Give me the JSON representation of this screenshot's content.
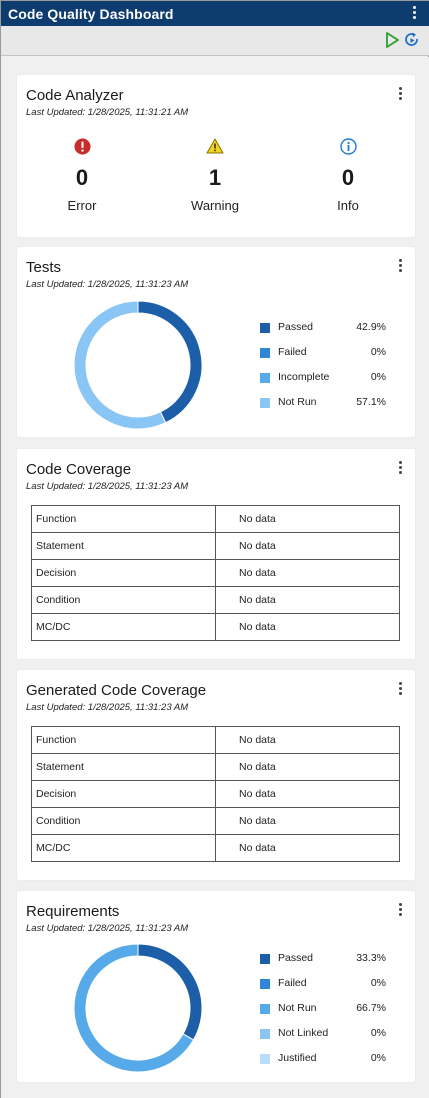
{
  "app": {
    "title": "Code Quality Dashboard"
  },
  "toolbar": {
    "run_icon": "play-icon",
    "refresh_icon": "refresh-icon"
  },
  "colors": {
    "titlebar": "#0e3c6e",
    "passed": "#1c5ea8",
    "failed": "#2e86d4",
    "notrun": "#8ac6f5",
    "incomplete": "#57aaea",
    "justified": "#b8dcfa",
    "error": "#c92a2a",
    "warning": "#e8c400",
    "info": "#1e7ad6"
  },
  "code_analyzer": {
    "title": "Code Analyzer",
    "updated": "Last Updated: 1/28/2025, 11:31:21 AM",
    "items": [
      {
        "label": "Error",
        "count": "0",
        "icon": "error-icon"
      },
      {
        "label": "Warning",
        "count": "1",
        "icon": "warning-icon"
      },
      {
        "label": "Info",
        "count": "0",
        "icon": "info-icon"
      }
    ]
  },
  "tests": {
    "title": "Tests",
    "updated": "Last Updated: 1/28/2025, 11:31:23 AM",
    "legend": [
      {
        "label": "Passed",
        "value": "42.9%",
        "fraction": 0.429,
        "color": "#1c5ea8"
      },
      {
        "label": "Failed",
        "value": "0%",
        "fraction": 0,
        "color": "#2e86d4"
      },
      {
        "label": "Incomplete",
        "value": "0%",
        "fraction": 0,
        "color": "#57aaea"
      },
      {
        "label": "Not Run",
        "value": "57.1%",
        "fraction": 0.571,
        "color": "#8ac6f5"
      }
    ]
  },
  "code_coverage": {
    "title": "Code Coverage",
    "updated": "Last Updated: 1/28/2025, 11:31:23 AM",
    "rows": [
      {
        "metric": "Function",
        "value": "No data"
      },
      {
        "metric": "Statement",
        "value": "No data"
      },
      {
        "metric": "Decision",
        "value": "No data"
      },
      {
        "metric": "Condition",
        "value": "No data"
      },
      {
        "metric": "MC/DC",
        "value": "No data"
      }
    ]
  },
  "generated_code_coverage": {
    "title": "Generated Code Coverage",
    "updated": "Last Updated: 1/28/2025, 11:31:23 AM",
    "rows": [
      {
        "metric": "Function",
        "value": "No data"
      },
      {
        "metric": "Statement",
        "value": "No data"
      },
      {
        "metric": "Decision",
        "value": "No data"
      },
      {
        "metric": "Condition",
        "value": "No data"
      },
      {
        "metric": "MC/DC",
        "value": "No data"
      }
    ]
  },
  "requirements": {
    "title": "Requirements",
    "updated": "Last Updated: 1/28/2025, 11:31:23 AM",
    "legend": [
      {
        "label": "Passed",
        "value": "33.3%",
        "fraction": 0.333,
        "color": "#1c5ea8"
      },
      {
        "label": "Failed",
        "value": "0%",
        "fraction": 0,
        "color": "#2e86d4"
      },
      {
        "label": "Not Run",
        "value": "66.7%",
        "fraction": 0.667,
        "color": "#57aaea"
      },
      {
        "label": "Not Linked",
        "value": "0%",
        "fraction": 0,
        "color": "#8ac6f5"
      },
      {
        "label": "Justified",
        "value": "0%",
        "fraction": 0,
        "color": "#b8dcfa"
      }
    ]
  }
}
